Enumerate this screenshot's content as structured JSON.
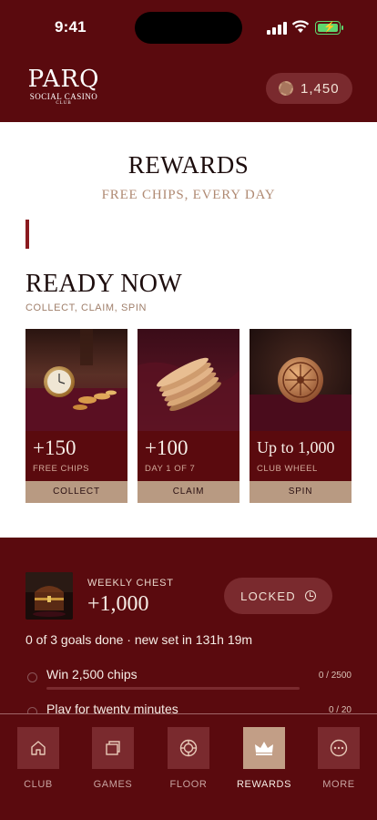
{
  "status_bar": {
    "time": "9:41"
  },
  "header": {
    "logo": {
      "main": "PARQ",
      "sub": "SOCIAL CASINO",
      "club": "CLUB"
    },
    "balance": "1,450",
    "balance_icon": "chip-icon"
  },
  "page": {
    "title": "REWARDS",
    "subtitle": "FREE CHIPS, EVERY DAY"
  },
  "ready_now": {
    "title": "READY NOW",
    "subtitle": "COLLECT, CLAIM, SPIN",
    "cards": [
      {
        "value": "+150",
        "desc": "FREE CHIPS",
        "button": "COLLECT",
        "image": "pocket-watch-and-chips"
      },
      {
        "value": "+100",
        "desc": "DAY 1 OF 7",
        "button": "CLAIM",
        "image": "stack-of-coins"
      },
      {
        "value": "Up to 1,000",
        "desc": "CLUB WHEEL",
        "button": "SPIN",
        "image": "wheel-coin"
      }
    ]
  },
  "weekly_chest": {
    "label": "WEEKLY CHEST",
    "value": "+1,000",
    "button": "LOCKED",
    "summary": "0 of 3 goals done · new set in 131h 19m",
    "goals": [
      {
        "text": "Win 2,500 chips",
        "progress": "0 / 2500",
        "fraction": 0
      },
      {
        "text": "Play for twenty minutes",
        "progress": "0 / 20",
        "fraction": 0
      }
    ]
  },
  "nav": {
    "items": [
      {
        "label": "CLUB",
        "icon": "home-icon"
      },
      {
        "label": "GAMES",
        "icon": "cards-icon"
      },
      {
        "label": "FLOOR",
        "icon": "chip-icon"
      },
      {
        "label": "REWARDS",
        "icon": "crown-icon",
        "active": true
      },
      {
        "label": "MORE",
        "icon": "more-icon"
      }
    ]
  },
  "colors": {
    "brand": "#5a0a0e",
    "accent": "#b89a82",
    "pill": "#7a2a2e"
  }
}
